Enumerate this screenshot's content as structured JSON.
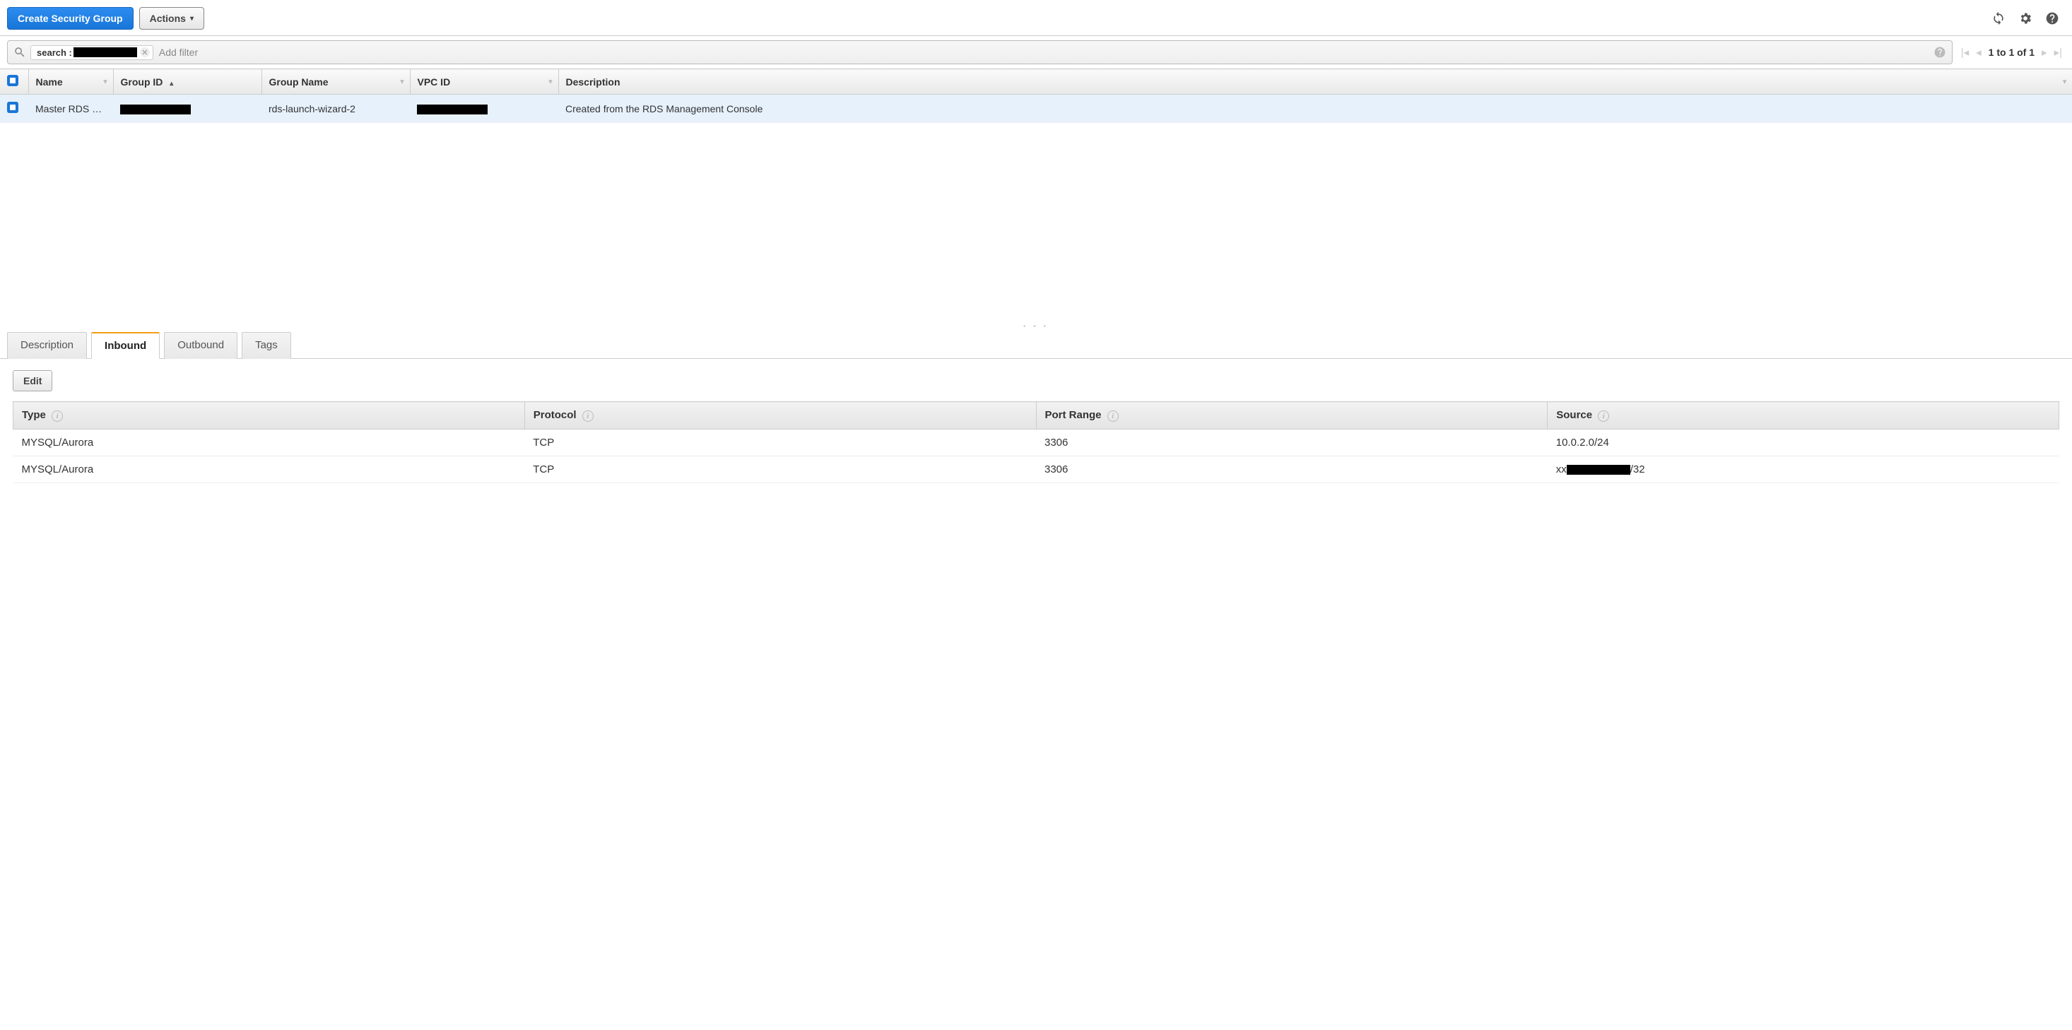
{
  "toolbar": {
    "create_label": "Create Security Group",
    "actions_label": "Actions"
  },
  "search": {
    "chip_prefix": "search :",
    "chip_value_redacted": true,
    "add_filter_placeholder": "Add filter"
  },
  "pagination": {
    "text": "1 to 1 of 1"
  },
  "columns": {
    "name": "Name",
    "group_id": "Group ID",
    "group_name": "Group Name",
    "vpc_id": "VPC ID",
    "description": "Description"
  },
  "rows": [
    {
      "selected": true,
      "name": "Master RDS …",
      "group_id_redacted": true,
      "group_name": "rds-launch-wizard-2",
      "vpc_id_redacted": true,
      "description": "Created from the RDS Management Console"
    }
  ],
  "tabs": {
    "description": "Description",
    "inbound": "Inbound",
    "outbound": "Outbound",
    "tags": "Tags",
    "active": "inbound"
  },
  "inbound_panel": {
    "edit_label": "Edit",
    "headers": {
      "type": "Type",
      "protocol": "Protocol",
      "port_range": "Port Range",
      "source": "Source"
    },
    "rules": [
      {
        "type": "MYSQL/Aurora",
        "protocol": "TCP",
        "port_range": "3306",
        "source": "10.0.2.0/24",
        "source_redacted": false
      },
      {
        "type": "MYSQL/Aurora",
        "protocol": "TCP",
        "port_range": "3306",
        "source_prefix": "xx",
        "source_suffix": "/32",
        "source_redacted": true
      }
    ]
  }
}
